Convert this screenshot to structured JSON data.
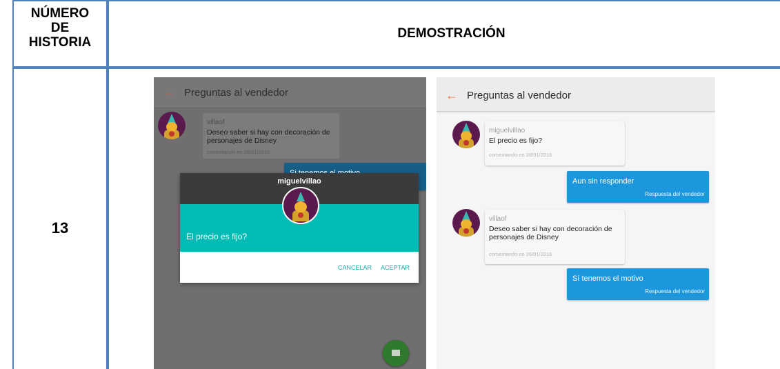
{
  "table": {
    "header_number": "NÚMERO DE HISTORIA",
    "header_number_lines": [
      "NÚMERO",
      "DE",
      "HISTORIA"
    ],
    "header_demo": "DEMOSTRACIÓN",
    "story_number": "13",
    "border_color": "#4f81bd"
  },
  "left_screen": {
    "title": "Preguntas al vendedor",
    "back_icon": "arrow-left-icon",
    "question": {
      "user": "villaof",
      "text_lines": [
        "Deseo saber si hay con decoración de",
        "personajes de Disney"
      ],
      "date": "comentando en 26/01/2016"
    },
    "answer_partial": "Si tenemos el motivo",
    "dialog": {
      "user": "miguelvillao",
      "question": "El precio es fijo?",
      "cancel": "CANCELAR",
      "accept": "ACEPTAR",
      "accent_color": "#00bcb5"
    },
    "fab_icon": "message-icon"
  },
  "right_screen": {
    "title": "Preguntas al vendedor",
    "back_icon": "arrow-left-icon",
    "threads": [
      {
        "user": "miguelvillao",
        "text_lines": [
          "El precio es fijo?"
        ],
        "date": "comentando en 28/01/2016",
        "answer": "Aun sin responder",
        "answer_label": "Respuesta del vendedor"
      },
      {
        "user": "villaof",
        "text_lines": [
          "Deseo saber si hay con decoración de",
          "personajes de Disney"
        ],
        "date": "comentando en 26/01/2016",
        "answer": "Sí tenemos el motivo",
        "answer_label": "Respuesta del vendedor"
      }
    ],
    "answer_color": "#1c97dd"
  }
}
